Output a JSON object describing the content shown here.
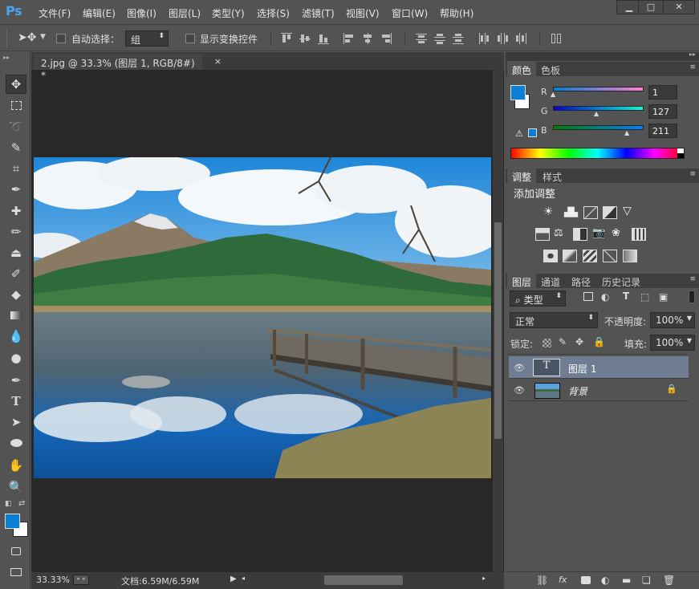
{
  "app": {
    "logo": "Ps"
  },
  "menu": [
    "文件(F)",
    "编辑(E)",
    "图像(I)",
    "图层(L)",
    "类型(Y)",
    "选择(S)",
    "滤镜(T)",
    "视图(V)",
    "窗口(W)",
    "帮助(H)"
  ],
  "window_controls": {
    "minimize": "▁",
    "maximize": "□",
    "close": "✕"
  },
  "options": {
    "auto_select_label": "自动选择：",
    "auto_select_value": "组",
    "show_transform_label": "显示变换控件"
  },
  "document": {
    "tab_title": "2.jpg @ 33.3% (图层 1, RGB/8#) *",
    "tab_close": "×",
    "zoom": "33.33%",
    "doc_info": "文档:6.59M/6.59M"
  },
  "color_panel": {
    "tabs": [
      "颜色",
      "色板"
    ],
    "foreground": "#0b7fd3",
    "background": "#ffffff",
    "r_label": "R",
    "r_value": "1",
    "g_label": "G",
    "g_value": "127",
    "b_label": "B",
    "b_value": "211"
  },
  "adjust_panel": {
    "tabs": [
      "调整",
      "样式"
    ],
    "title": "添加调整"
  },
  "layers_panel": {
    "tabs": [
      "图层",
      "通道",
      "路径",
      "历史记录"
    ],
    "filter_label": "类型",
    "blend_mode": "正常",
    "opacity_label": "不透明度:",
    "opacity_value": "100%",
    "lock_label": "锁定:",
    "fill_label": "填充:",
    "fill_value": "100%",
    "layers": [
      {
        "name": "图层 1",
        "type": "text",
        "thumb_glyph": "T",
        "selected": true
      },
      {
        "name": "背景",
        "type": "image",
        "locked": true,
        "selected": false
      }
    ]
  },
  "colors": {
    "accent": "#0b7fd3",
    "panel": "#535353",
    "canvas_bg": "#282828",
    "selection": "#6f7d92"
  }
}
